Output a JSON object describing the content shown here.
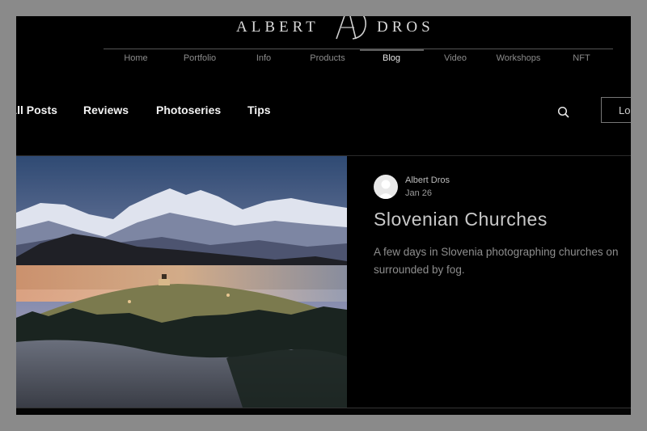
{
  "site": {
    "logo_left": "ALBERT",
    "logo_right": "DROS"
  },
  "nav": {
    "items": [
      {
        "label": "Home"
      },
      {
        "label": "Portfolio"
      },
      {
        "label": "Info"
      },
      {
        "label": "Products"
      },
      {
        "label": "Blog"
      },
      {
        "label": "Video"
      },
      {
        "label": "Workshops"
      },
      {
        "label": "NFT"
      }
    ],
    "active": "Blog"
  },
  "blog_menu": {
    "categories": [
      {
        "label": "All Posts"
      },
      {
        "label": "Reviews"
      },
      {
        "label": "Photoseries"
      },
      {
        "label": "Tips"
      }
    ],
    "login_label": "Lo"
  },
  "icons": {
    "search": "search-icon",
    "avatar": "user-avatar-icon",
    "logo_mark": "ad-monogram-icon"
  },
  "post": {
    "author": "Albert Dros",
    "date": "Jan 26",
    "title": "Slovenian Churches",
    "excerpt": "A few days in Slovenia photographing churches on surrounded by fog."
  },
  "colors": {
    "background": "#000000",
    "frame": "#8a8a8a",
    "text_primary": "#f2f2f2",
    "text_muted": "#8e8e8e"
  }
}
